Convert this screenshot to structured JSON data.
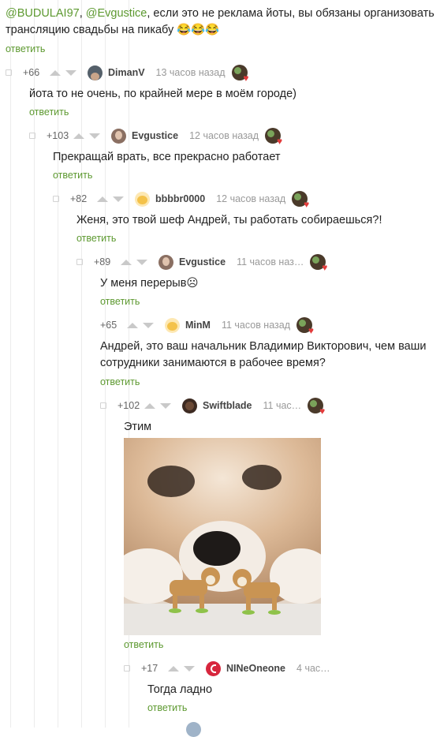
{
  "colors": {
    "accent": "#5d9930",
    "text": "#222222",
    "meta": "#999999"
  },
  "top_comment": {
    "mention1": "@BUDULAI97",
    "sep": ", ",
    "mention2": "@Evgustice",
    "text_line1_rest": ", если это не реклама йоты, вы обязаны организовать",
    "text_line2": "трансляцию свадьбы на пикабу 😂😂😂",
    "reply": "ответить"
  },
  "comments": [
    {
      "rating": "+66",
      "user": "DimanV",
      "time": "13 часов назад",
      "text": "йота то не очень, по крайней мере в моём городе)",
      "reply": "ответить",
      "avatar_icon": "man-avatar"
    },
    {
      "rating": "+103",
      "user": "Evgustice",
      "time": "12 часов назад",
      "text": "Прекращай врать, все прекрасно работает",
      "reply": "ответить",
      "avatar_icon": "woman-avatar"
    },
    {
      "rating": "+82",
      "user": "bbbbr0000",
      "time": "12 часов назад",
      "text": "Женя,  это твой шеф Андрей, ты работать собираешься?!",
      "reply": "ответить",
      "avatar_icon": "emoji-avatar"
    },
    {
      "rating": "+89",
      "user": "Evgustice",
      "time": "11 часов наз…",
      "text": "У меня перерыв☹",
      "reply": "ответить",
      "avatar_icon": "woman-avatar"
    },
    {
      "rating": "+65",
      "user": "MinM",
      "time": "11 часов назад",
      "text_line1": "Андрей, это ваш начальник Владимир Викторович, чем ваши",
      "text_line2": "сотрудники занимаются в рабочее время?",
      "reply": "ответить",
      "avatar_icon": "emoji-avatar"
    },
    {
      "rating": "+102",
      "user": "Swiftblade",
      "time": "11 час…",
      "text": "Этим",
      "reply": "ответить",
      "avatar_icon": "dark-avatar",
      "image": "shiba-dog-with-toy-dogs-photo"
    },
    {
      "rating": "+17",
      "user": "NINeOneone",
      "time": "4 час…",
      "text": "Тогда ладно",
      "reply": "ответить",
      "avatar_icon": "red-logo-avatar"
    }
  ]
}
